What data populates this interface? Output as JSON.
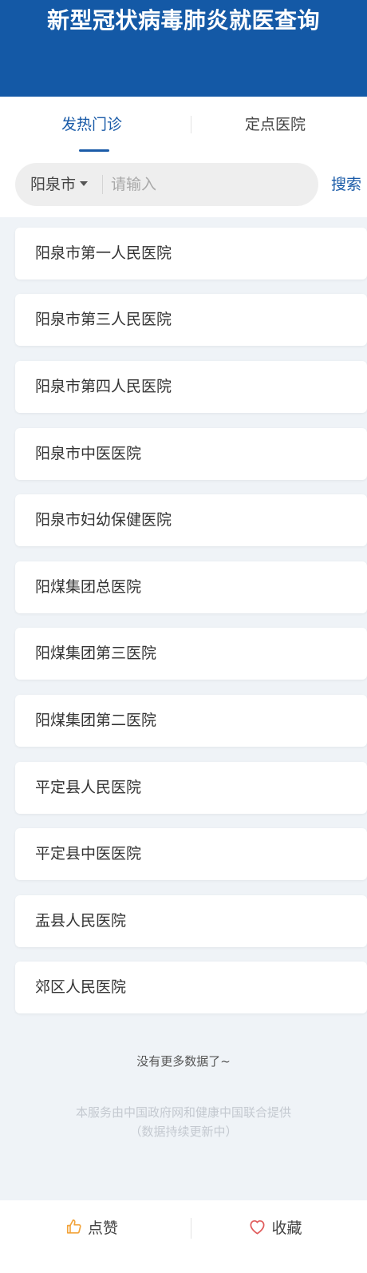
{
  "header": {
    "title": "新型冠状病毒肺炎就医查询"
  },
  "tabs": [
    {
      "label": "发热门诊",
      "active": true
    },
    {
      "label": "定点医院",
      "active": false
    }
  ],
  "search": {
    "city": "阳泉市",
    "placeholder": "请输入",
    "value": "",
    "button_label": "搜索"
  },
  "hospitals": [
    "阳泉市第一人民医院",
    "阳泉市第三人民医院",
    "阳泉市第四人民医院",
    "阳泉市中医医院",
    "阳泉市妇幼保健医院",
    "阳煤集团总医院",
    "阳煤集团第三医院",
    "阳煤集团第二医院",
    "平定县人民医院",
    "平定县中医医院",
    "盂县人民医院",
    "郊区人民医院"
  ],
  "list_end_text": "没有更多数据了~",
  "footer": {
    "line1": "本服务由中国政府网和健康中国联合提供",
    "line2": "（数据持续更新中）"
  },
  "bottom_bar": {
    "like_label": "点赞",
    "like_icon": "thumbs-up-icon",
    "favorite_label": "收藏",
    "favorite_icon": "heart-icon"
  },
  "colors": {
    "header_bg": "#1459a6",
    "accent": "#1a5ba8",
    "like_icon": "#f2a33a",
    "favorite_icon": "#e05b5b"
  }
}
